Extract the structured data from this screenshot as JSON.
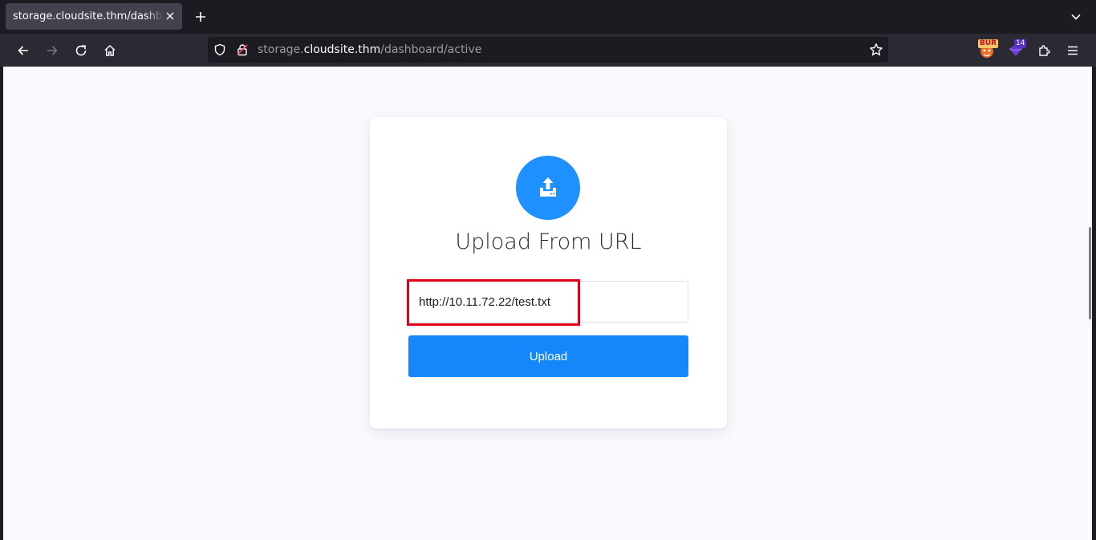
{
  "tab": {
    "title": "storage.cloudsite.thm/dashboard/active"
  },
  "address_bar": {
    "url_prefix": "storage.",
    "url_host": "cloudsite.thm",
    "url_path": "/dashboard/active"
  },
  "extensions": {
    "burp_badge": "BUR",
    "counter_badge": "14"
  },
  "upload_card": {
    "title": "Upload From URL",
    "input_value": "http://10.11.72.22/test.txt",
    "button_label": "Upload",
    "accent_color": "#1e90ff"
  },
  "annotation": {
    "highlight_color": "#e0001a"
  }
}
